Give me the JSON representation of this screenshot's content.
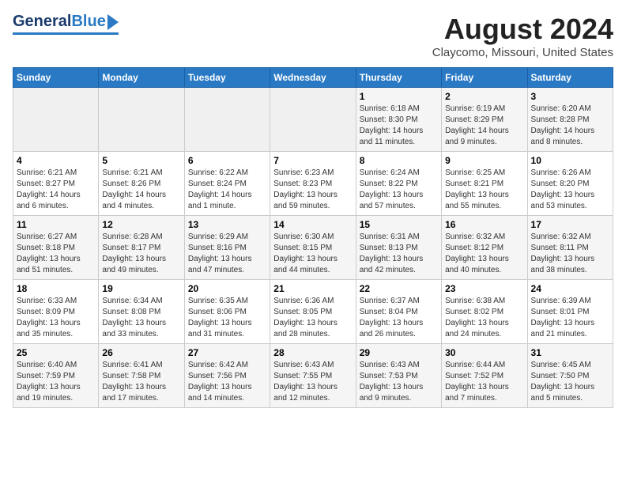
{
  "header": {
    "logo_general": "General",
    "logo_blue": "Blue",
    "month_title": "August 2024",
    "location": "Claycomo, Missouri, United States"
  },
  "days_of_week": [
    "Sunday",
    "Monday",
    "Tuesday",
    "Wednesday",
    "Thursday",
    "Friday",
    "Saturday"
  ],
  "weeks": [
    [
      {
        "day": "",
        "info": ""
      },
      {
        "day": "",
        "info": ""
      },
      {
        "day": "",
        "info": ""
      },
      {
        "day": "",
        "info": ""
      },
      {
        "day": "1",
        "info": "Sunrise: 6:18 AM\nSunset: 8:30 PM\nDaylight: 14 hours\nand 11 minutes."
      },
      {
        "day": "2",
        "info": "Sunrise: 6:19 AM\nSunset: 8:29 PM\nDaylight: 14 hours\nand 9 minutes."
      },
      {
        "day": "3",
        "info": "Sunrise: 6:20 AM\nSunset: 8:28 PM\nDaylight: 14 hours\nand 8 minutes."
      }
    ],
    [
      {
        "day": "4",
        "info": "Sunrise: 6:21 AM\nSunset: 8:27 PM\nDaylight: 14 hours\nand 6 minutes."
      },
      {
        "day": "5",
        "info": "Sunrise: 6:21 AM\nSunset: 8:26 PM\nDaylight: 14 hours\nand 4 minutes."
      },
      {
        "day": "6",
        "info": "Sunrise: 6:22 AM\nSunset: 8:24 PM\nDaylight: 14 hours\nand 1 minute."
      },
      {
        "day": "7",
        "info": "Sunrise: 6:23 AM\nSunset: 8:23 PM\nDaylight: 13 hours\nand 59 minutes."
      },
      {
        "day": "8",
        "info": "Sunrise: 6:24 AM\nSunset: 8:22 PM\nDaylight: 13 hours\nand 57 minutes."
      },
      {
        "day": "9",
        "info": "Sunrise: 6:25 AM\nSunset: 8:21 PM\nDaylight: 13 hours\nand 55 minutes."
      },
      {
        "day": "10",
        "info": "Sunrise: 6:26 AM\nSunset: 8:20 PM\nDaylight: 13 hours\nand 53 minutes."
      }
    ],
    [
      {
        "day": "11",
        "info": "Sunrise: 6:27 AM\nSunset: 8:18 PM\nDaylight: 13 hours\nand 51 minutes."
      },
      {
        "day": "12",
        "info": "Sunrise: 6:28 AM\nSunset: 8:17 PM\nDaylight: 13 hours\nand 49 minutes."
      },
      {
        "day": "13",
        "info": "Sunrise: 6:29 AM\nSunset: 8:16 PM\nDaylight: 13 hours\nand 47 minutes."
      },
      {
        "day": "14",
        "info": "Sunrise: 6:30 AM\nSunset: 8:15 PM\nDaylight: 13 hours\nand 44 minutes."
      },
      {
        "day": "15",
        "info": "Sunrise: 6:31 AM\nSunset: 8:13 PM\nDaylight: 13 hours\nand 42 minutes."
      },
      {
        "day": "16",
        "info": "Sunrise: 6:32 AM\nSunset: 8:12 PM\nDaylight: 13 hours\nand 40 minutes."
      },
      {
        "day": "17",
        "info": "Sunrise: 6:32 AM\nSunset: 8:11 PM\nDaylight: 13 hours\nand 38 minutes."
      }
    ],
    [
      {
        "day": "18",
        "info": "Sunrise: 6:33 AM\nSunset: 8:09 PM\nDaylight: 13 hours\nand 35 minutes."
      },
      {
        "day": "19",
        "info": "Sunrise: 6:34 AM\nSunset: 8:08 PM\nDaylight: 13 hours\nand 33 minutes."
      },
      {
        "day": "20",
        "info": "Sunrise: 6:35 AM\nSunset: 8:06 PM\nDaylight: 13 hours\nand 31 minutes."
      },
      {
        "day": "21",
        "info": "Sunrise: 6:36 AM\nSunset: 8:05 PM\nDaylight: 13 hours\nand 28 minutes."
      },
      {
        "day": "22",
        "info": "Sunrise: 6:37 AM\nSunset: 8:04 PM\nDaylight: 13 hours\nand 26 minutes."
      },
      {
        "day": "23",
        "info": "Sunrise: 6:38 AM\nSunset: 8:02 PM\nDaylight: 13 hours\nand 24 minutes."
      },
      {
        "day": "24",
        "info": "Sunrise: 6:39 AM\nSunset: 8:01 PM\nDaylight: 13 hours\nand 21 minutes."
      }
    ],
    [
      {
        "day": "25",
        "info": "Sunrise: 6:40 AM\nSunset: 7:59 PM\nDaylight: 13 hours\nand 19 minutes."
      },
      {
        "day": "26",
        "info": "Sunrise: 6:41 AM\nSunset: 7:58 PM\nDaylight: 13 hours\nand 17 minutes."
      },
      {
        "day": "27",
        "info": "Sunrise: 6:42 AM\nSunset: 7:56 PM\nDaylight: 13 hours\nand 14 minutes."
      },
      {
        "day": "28",
        "info": "Sunrise: 6:43 AM\nSunset: 7:55 PM\nDaylight: 13 hours\nand 12 minutes."
      },
      {
        "day": "29",
        "info": "Sunrise: 6:43 AM\nSunset: 7:53 PM\nDaylight: 13 hours\nand 9 minutes."
      },
      {
        "day": "30",
        "info": "Sunrise: 6:44 AM\nSunset: 7:52 PM\nDaylight: 13 hours\nand 7 minutes."
      },
      {
        "day": "31",
        "info": "Sunrise: 6:45 AM\nSunset: 7:50 PM\nDaylight: 13 hours\nand 5 minutes."
      }
    ]
  ]
}
